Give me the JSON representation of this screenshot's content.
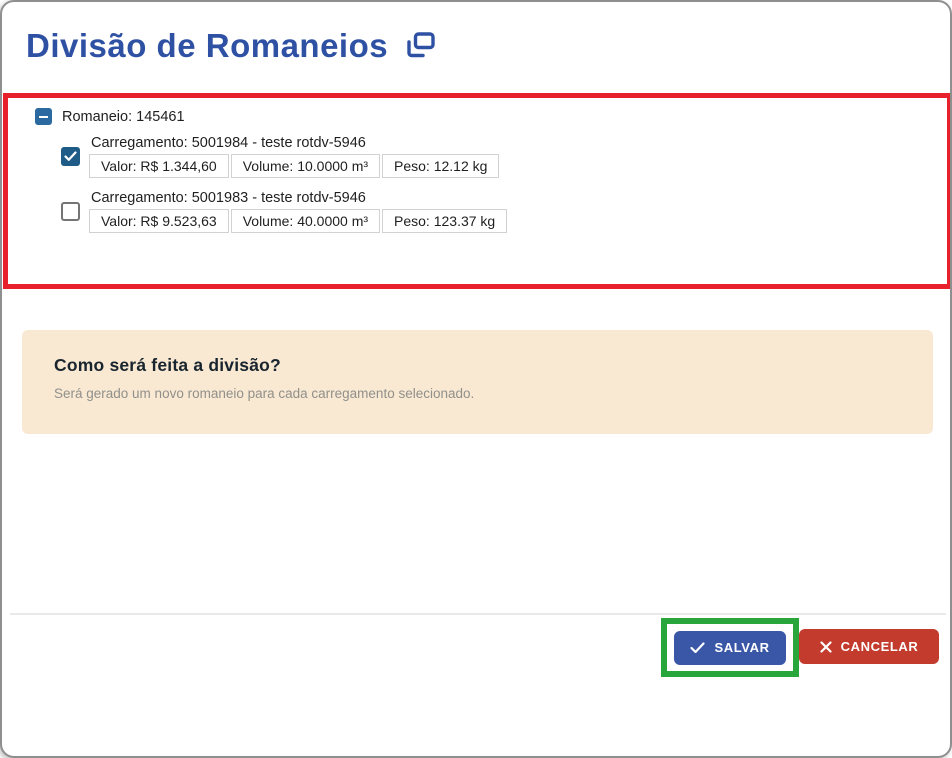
{
  "header": {
    "title": "Divisão de Romaneios",
    "title_icon": "duplicate-stack-icon"
  },
  "tree": {
    "romaneio_label": "Romaneio: 145461",
    "toggle_state": "expanded",
    "carregamentos": [
      {
        "label": "Carregamento: 5001984 - teste rotdv-5946",
        "checked": true,
        "stats": [
          "Valor: R$ 1.344,60",
          "Volume: 10.0000 m³",
          "Peso: 12.12 kg"
        ]
      },
      {
        "label": "Carregamento: 5001983 - teste rotdv-5946",
        "checked": false,
        "stats": [
          "Valor: R$ 9.523,63",
          "Volume: 40.0000 m³",
          "Peso: 123.37 kg"
        ]
      }
    ]
  },
  "info_box": {
    "title": "Como será feita a divisão?",
    "description": "Será gerado um novo romaneio para cada carregamento selecionado."
  },
  "actions": {
    "save_label": "SALVAR",
    "cancel_label": "CANCELAR"
  },
  "annotations": {
    "red_box_color": "#e7202b",
    "green_box_color": "#28a63c"
  },
  "colors": {
    "title_blue": "#2e51a4",
    "toggle_blue": "#2a6aa0",
    "checkbox_blue": "#1e5b86",
    "info_box_bg": "#f9e8d2",
    "save_button_bg": "#3a57a7",
    "cancel_button_bg": "#c23b2d"
  }
}
